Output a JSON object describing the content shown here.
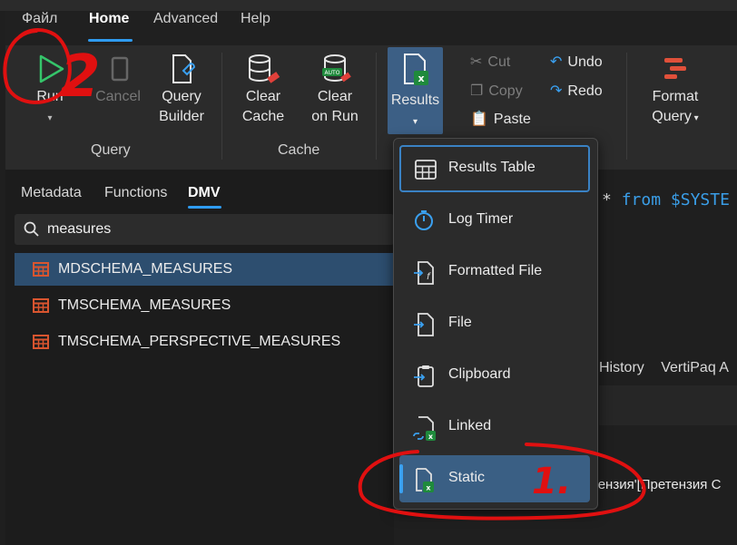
{
  "tabs": [
    {
      "label": "Файл"
    },
    {
      "label": "Home"
    },
    {
      "label": "Advanced"
    },
    {
      "label": "Help"
    }
  ],
  "ribbon": {
    "run": "Run",
    "cancel": "Cancel",
    "query_builder_line1": "Query",
    "query_builder_line2": "Builder",
    "query_group": "Query",
    "clear_cache_line1": "Clear",
    "clear_cache_line2": "Cache",
    "clear_on_run_line1": "Clear",
    "clear_on_run_line2": "on Run",
    "cache_group": "Cache",
    "results": "Results",
    "cut": "Cut",
    "copy": "Copy",
    "paste": "Paste",
    "undo": "Undo",
    "redo": "Redo",
    "format_line1": "Format",
    "format_line2": "Query"
  },
  "left_panel": {
    "tabs": [
      {
        "label": "Metadata"
      },
      {
        "label": "Functions"
      },
      {
        "label": "DMV"
      }
    ],
    "search_value": "measures",
    "items": [
      {
        "label": "MDSCHEMA_MEASURES"
      },
      {
        "label": "TMSCHEMA_MEASURES"
      },
      {
        "label": "TMSCHEMA_PERSPECTIVE_MEASURES"
      }
    ]
  },
  "editor": {
    "star": "*",
    "from_kw": "from",
    "system_text": "$SYSTE"
  },
  "output_tabs": {
    "history": "History",
    "vertipaq": "VertiPaq A"
  },
  "result_text": "тензия'[Претензия С",
  "results_menu": [
    {
      "label": "Results Table"
    },
    {
      "label": "Log Timer"
    },
    {
      "label": "Formatted File"
    },
    {
      "label": "File"
    },
    {
      "label": "Clipboard"
    },
    {
      "label": "Linked"
    },
    {
      "label": "Static"
    }
  ],
  "annotations": {
    "two": "2",
    "one": "1."
  },
  "colors": {
    "accent": "#2f9bf0",
    "selected_row": "#2d4e6f",
    "annotation": "#e01010",
    "excel_green": "#1f8a3c",
    "table_icon": "#d9552f"
  }
}
